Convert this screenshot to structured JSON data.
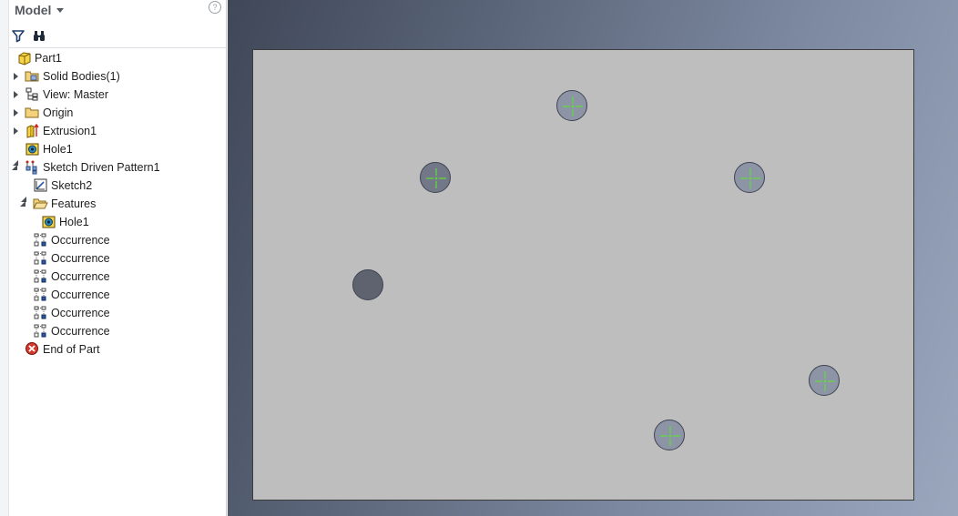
{
  "browser": {
    "title": "Model",
    "help_glyph": "?",
    "toolbar": {
      "filter_icon": "filter-icon",
      "find_icon": "binoculars-icon"
    },
    "tree": [
      {
        "label": "Part1",
        "icon": "part-icon",
        "expander": "none"
      },
      {
        "label": "Solid Bodies(1)",
        "icon": "folder-solids-icon",
        "expander": "closed"
      },
      {
        "label": "View: Master",
        "icon": "view-rep-icon",
        "expander": "closed"
      },
      {
        "label": "Origin",
        "icon": "folder-icon",
        "expander": "closed"
      },
      {
        "label": "Extrusion1",
        "icon": "extrusion-icon",
        "expander": "closed"
      },
      {
        "label": "Hole1",
        "icon": "hole-feature-icon",
        "expander": "none"
      },
      {
        "label": "Sketch Driven Pattern1",
        "icon": "sketch-pattern-icon",
        "expander": "open"
      },
      {
        "label": "Sketch2",
        "icon": "sketch-icon",
        "expander": "none"
      },
      {
        "label": "Features",
        "icon": "folder-open-icon",
        "expander": "open"
      },
      {
        "label": "Hole1",
        "icon": "hole-feature-icon",
        "expander": "none"
      },
      {
        "label": "Occurrence",
        "icon": "occurrence-icon",
        "expander": "none"
      },
      {
        "label": "Occurrence",
        "icon": "occurrence-icon",
        "expander": "none"
      },
      {
        "label": "Occurrence",
        "icon": "occurrence-icon",
        "expander": "none"
      },
      {
        "label": "Occurrence",
        "icon": "occurrence-icon",
        "expander": "none"
      },
      {
        "label": "Occurrence",
        "icon": "occurrence-icon",
        "expander": "none"
      },
      {
        "label": "Occurrence",
        "icon": "occurrence-icon",
        "expander": "none"
      },
      {
        "label": "End of Part",
        "icon": "end-of-part-icon",
        "expander": "none"
      }
    ]
  },
  "viewport": {
    "plate_color": "#bebebe",
    "hole_dark_color": "#5f6370",
    "hole_pattern_color": "#8d94a6",
    "center_mark_color": "#5fdc3a"
  }
}
